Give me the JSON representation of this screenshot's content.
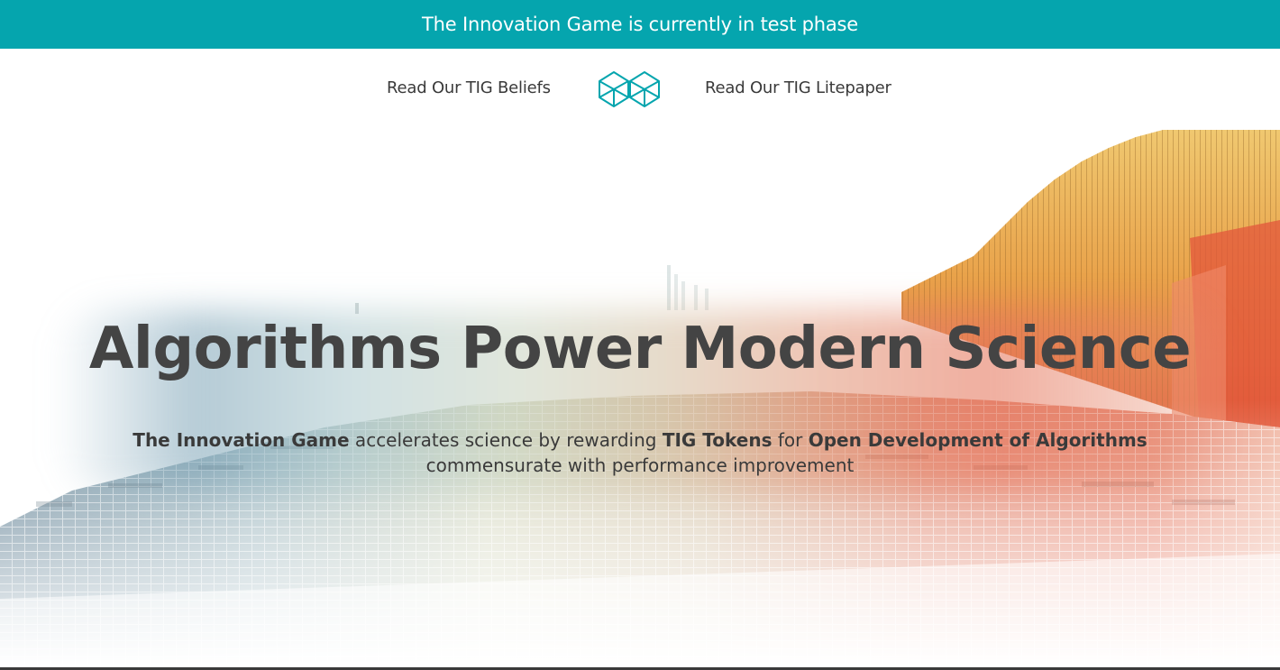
{
  "banner": {
    "text": "The Innovation Game is currently in test phase",
    "color": "#05a5ae"
  },
  "nav": {
    "beliefs_link": "Read Our TIG Beliefs",
    "litepaper_link": "Read Our TIG Litepaper",
    "logo_icon": "tig-logo-icon",
    "logo_color": "#05a5ae"
  },
  "hero": {
    "headline": "Algorithms Power Modern Science",
    "sub": {
      "part1_bold": "The Innovation Game",
      "part2": " accelerates science by rewarding ",
      "part3_bold": "TIG Tokens",
      "part4": " for ",
      "part5_bold": "Open Development of Algorithms",
      "line2": "commensurate with performance improvement"
    }
  }
}
